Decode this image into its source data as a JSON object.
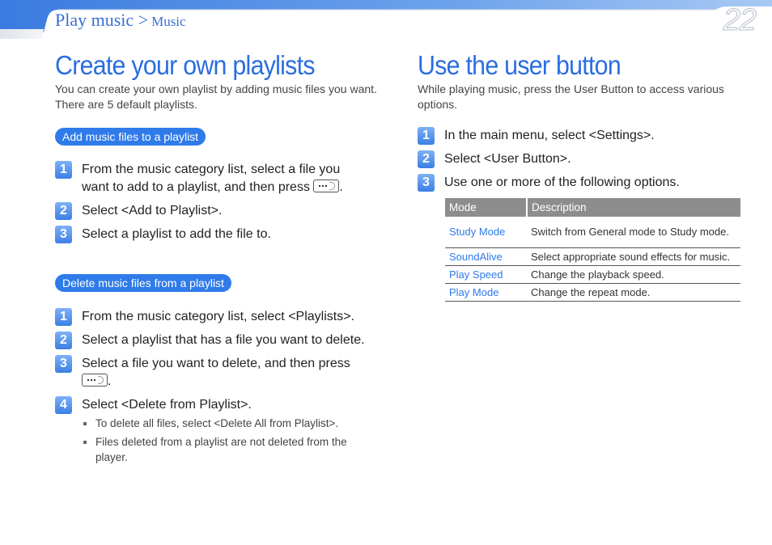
{
  "header": {
    "breadcrumb_main": "Play music >",
    "breadcrumb_sub": "Music",
    "page_number": "22"
  },
  "left": {
    "title": "Create your own playlists",
    "intro": "You can create your own playlist by adding music files you want. There are 5 default playlists.",
    "section1": {
      "heading": "Add music files to a playlist",
      "steps": [
        {
          "num": "1",
          "text_a": "From the music category list, select a file you want to add to a playlist, and then press",
          "text_b": "."
        },
        {
          "num": "2",
          "text": "Select <Add to Playlist>."
        },
        {
          "num": "3",
          "text": "Select a playlist to add the file to."
        }
      ]
    },
    "section2": {
      "heading": "Delete music files from a playlist",
      "steps": [
        {
          "num": "1",
          "text": "From the music category list, select <Playlists>."
        },
        {
          "num": "2",
          "text": "Select a playlist that has a file you want to delete."
        },
        {
          "num": "3",
          "text_a": "Select a file you want to delete, and then press",
          "text_b": "."
        },
        {
          "num": "4",
          "text": "Select <Delete from Playlist>."
        }
      ],
      "notes": [
        "To delete all files, select <Delete All from Playlist>.",
        "Files deleted from a playlist are not deleted from the player."
      ]
    }
  },
  "right": {
    "title": "Use the user button",
    "intro": "While playing music, press the User Button to access various options.",
    "steps": [
      {
        "num": "1",
        "text": "In the main menu, select <Settings>."
      },
      {
        "num": "2",
        "text": "Select <User Button>."
      },
      {
        "num": "3",
        "text": "Use one or more of the following options."
      }
    ],
    "table": {
      "headers": [
        "Mode",
        "Description"
      ],
      "rows": [
        {
          "mode": "Study Mode",
          "desc": "Switch from General mode to Study mode."
        },
        {
          "mode": "SoundAlive",
          "desc": "Select appropriate sound effects for music."
        },
        {
          "mode": "Play Speed",
          "desc": "Change the playback speed."
        },
        {
          "mode": "Play Mode",
          "desc": "Change the repeat mode."
        }
      ]
    }
  },
  "colors": {
    "accent": "#2a6ee0",
    "pill": "#2f7bea",
    "table_header": "#8d8d8d"
  }
}
